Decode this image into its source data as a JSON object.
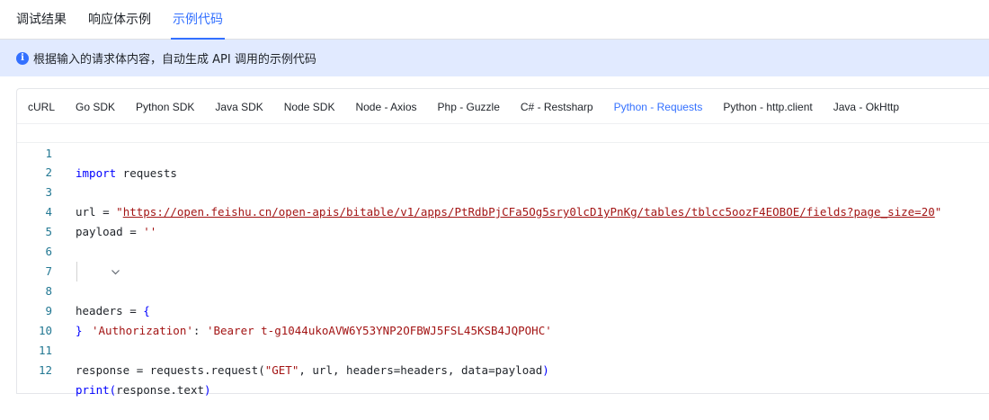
{
  "top_tabs": [
    {
      "label": "调试结果",
      "active": false
    },
    {
      "label": "响应体示例",
      "active": false
    },
    {
      "label": "示例代码",
      "active": true
    }
  ],
  "info": {
    "icon": "info-icon",
    "text": "根据输入的请求体内容，自动生成 API 调用的示例代码"
  },
  "lang_tabs": [
    {
      "label": "cURL",
      "active": false
    },
    {
      "label": "Go SDK",
      "active": false
    },
    {
      "label": "Python SDK",
      "active": false
    },
    {
      "label": "Java SDK",
      "active": false
    },
    {
      "label": "Node SDK",
      "active": false
    },
    {
      "label": "Node - Axios",
      "active": false
    },
    {
      "label": "Php - Guzzle",
      "active": false
    },
    {
      "label": "C# - Restsharp",
      "active": false
    },
    {
      "label": "Python - Requests",
      "active": true
    },
    {
      "label": "Python - http.client",
      "active": false
    },
    {
      "label": "Java - OkHttp",
      "active": false
    }
  ],
  "code": {
    "line_numbers": [
      "1",
      "2",
      "3",
      "4",
      "5",
      "6",
      "7",
      "8",
      "9",
      "10",
      "11",
      "12"
    ],
    "l1_kw": "import",
    "l1_rest": " requests",
    "l3_pre": "url = ",
    "l3_q1": "\"",
    "l3_url": "https://open.feishu.cn/open-apis/bitable/v1/apps/PtRdbPjCFa5Og5sry0lcD1yPnKg/tables/tblcc5oozF4EOBOE/fields?page_size=20",
    "l3_q2": "\"",
    "l4_pre": "payload = ",
    "l4_str": "''",
    "l7_pre": "headers = ",
    "l7_brace": "{",
    "l8_key": "'Authorization'",
    "l8_colon": ": ",
    "l8_val": "'Bearer t-g1044ukoAVW6Y53YNP2OFBWJ5FSL45KSB4JQPOHC'",
    "l9_brace": "}",
    "l11_pre": "response = requests.request(",
    "l11_str": "\"GET\"",
    "l11_post": ", url, headers=headers, data=payload",
    "l11_paren": ")",
    "l12_kw": "print",
    "l12_paren1": "(",
    "l12_mid": "response.text",
    "l12_paren2": ")"
  }
}
